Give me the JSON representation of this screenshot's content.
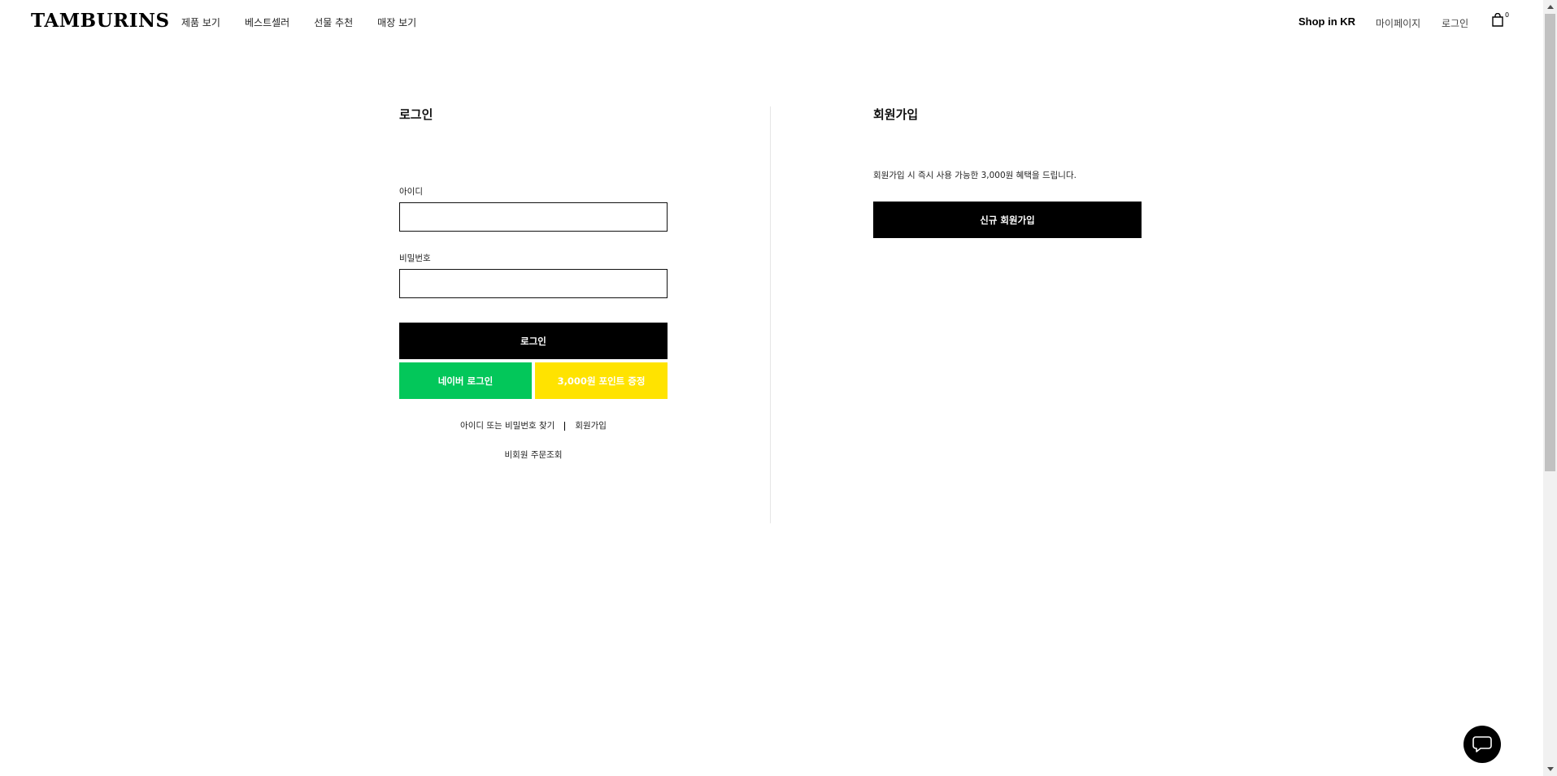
{
  "header": {
    "logo": "TAMBURINS",
    "nav": [
      {
        "label": "제품 보기"
      },
      {
        "label": "베스트셀러"
      },
      {
        "label": "선물 추천"
      },
      {
        "label": "매장 보기"
      }
    ],
    "shop_region": "Shop in KR",
    "mypage": "마이페이지",
    "login": "로그인",
    "cart_count": "0"
  },
  "login": {
    "title": "로그인",
    "id_label": "아이디",
    "id_value": "",
    "password_label": "비밀번호",
    "password_value": "",
    "login_button": "로그인",
    "naver_button": "네이버 로그인",
    "point_button": "3,000원 포인트 증정",
    "find_link": "아이디 또는 비밀번호 찾기",
    "join_link": "회원가입",
    "guest_order_link": "비회원 주문조회"
  },
  "join": {
    "title": "회원가입",
    "description": "회원가입 시 즉시 사용 가능한 3,000원 혜택을 드립니다.",
    "signup_button": "신규 회원가입"
  },
  "colors": {
    "primary": "#000000",
    "naver_green": "#03c75a",
    "point_yellow": "#ffe300",
    "divider": "#e6e6e6"
  },
  "icons": {
    "cart": "shopping-bag-icon",
    "chat": "chat-bubble-icon"
  }
}
